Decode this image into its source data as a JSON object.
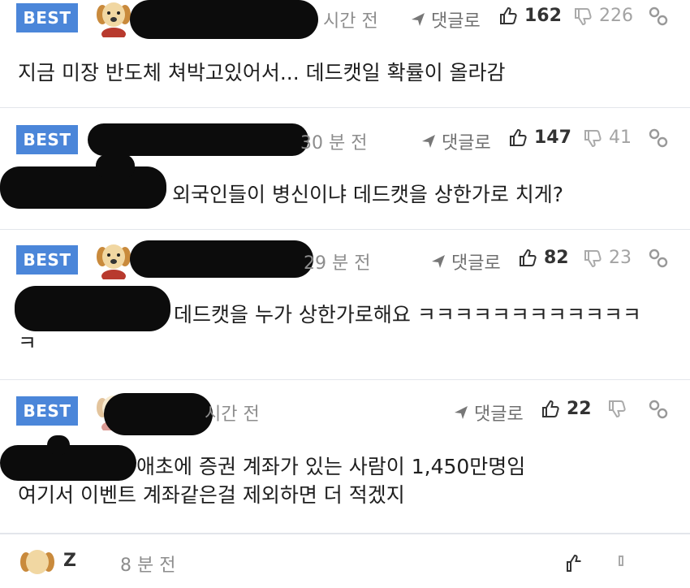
{
  "comments": [
    {
      "badge": "BEST",
      "time": "시간 전",
      "reply_label": "댓글로",
      "likes": "162",
      "dislikes": "226",
      "lines": [
        "지금 미장 반도체 쳐박고있어서... 데드캣일 확률이 올라감"
      ]
    },
    {
      "badge": "BEST",
      "time": "30 분 전",
      "reply_label": "댓글로",
      "likes": "147",
      "dislikes": "41",
      "lines": [
        "외국인들이 병신이냐 데드캣을 상한가로 치게?"
      ]
    },
    {
      "badge": "BEST",
      "time": "29 분 전",
      "reply_label": "댓글로",
      "likes": "82",
      "dislikes": "23",
      "lines": [
        "데드캣을 누가 상한가로해요 ㅋㅋㅋㅋㅋㅋㅋㅋㅋㅋㅋㅋ",
        "ㅋ"
      ]
    },
    {
      "badge": "BEST",
      "time": "시간 전",
      "reply_label": "댓글로",
      "likes": "22",
      "dislikes": "",
      "lines": [
        "애초에 증권 계좌가 있는 사람이 1,450만명임",
        "여기서 이벤트 계좌같은걸 제외하면 더 적겠지"
      ]
    }
  ],
  "next_comment": {
    "author_partial": "Z",
    "time": "8 분 전"
  },
  "icons": {
    "reply": "reply-arrow-icon",
    "like": "thumbs-up-icon",
    "dislike": "thumbs-down-icon",
    "link": "link-icon",
    "avatar": "puppy-avatar"
  },
  "colors": {
    "badge": "#4b86d9",
    "separator": "#e3e6eb",
    "muted": "#8d8d8d"
  }
}
